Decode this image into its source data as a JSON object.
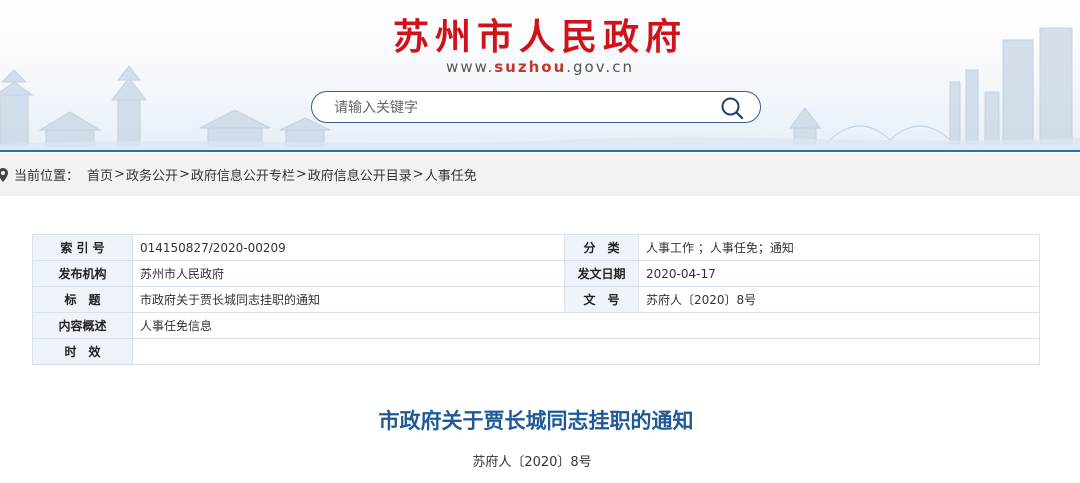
{
  "header": {
    "site_title": "苏州市人民政府",
    "url_prefix": "www.",
    "url_domain": "suzhou",
    "url_suffix": ".gov.cn",
    "search_placeholder": "请输入关键字",
    "search_icon": "search-icon"
  },
  "breadcrumb": {
    "pin_icon": "location-pin-icon",
    "label": "当前位置：",
    "items": [
      "首页",
      "政务公开",
      "政府信息公开专栏",
      "政府信息公开目录",
      "人事任免"
    ],
    "separator": ">"
  },
  "info_table": {
    "index_label": "索 引 号",
    "index_value": "014150827/2020-00209",
    "category_label": "分　类",
    "category_value": "人事工作 ；人事任免；通知",
    "publisher_label": "发布机构",
    "publisher_value": "苏州市人民政府",
    "date_label": "发文日期",
    "date_value": "2020-04-17",
    "title_label": "标　题",
    "title_value": "市政府关于贾长城同志挂职的通知",
    "docno_label": "文　号",
    "docno_value": "苏府人〔2020〕8号",
    "summary_label": "内容概述",
    "summary_value": "人事任免信息",
    "validity_label": "时　效",
    "validity_value": ""
  },
  "article": {
    "title": "市政府关于贾长城同志挂职的通知",
    "doc_number": "苏府人〔2020〕8号"
  },
  "colors": {
    "brand_red": "#d0121b",
    "title_blue": "#1f5a97",
    "header_line": "#2c6cb3",
    "label_bg": "#eef3fa"
  }
}
